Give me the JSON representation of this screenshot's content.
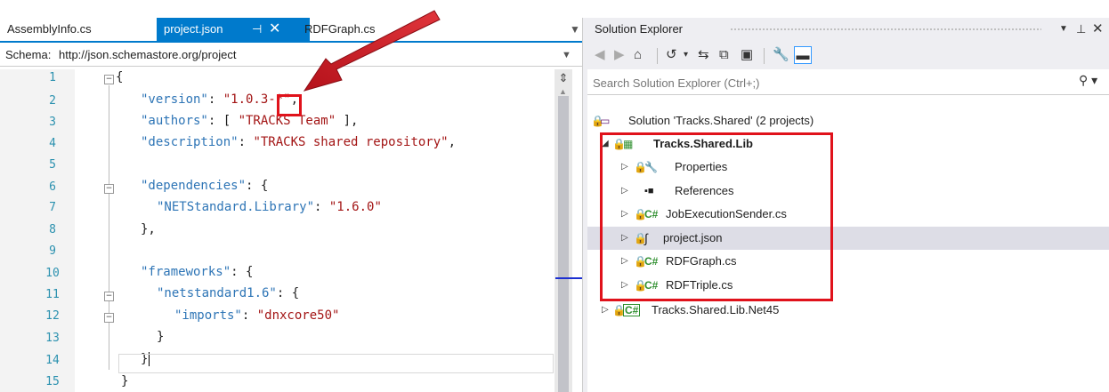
{
  "editor": {
    "tabs": [
      {
        "label": "AssemblyInfo.cs"
      },
      {
        "label": "project.json",
        "active": true
      },
      {
        "label": "RDFGraph.cs"
      }
    ],
    "pin_icon": "pin-icon",
    "close_icon": "close-icon",
    "schema_label": "Schema:",
    "schema_value": "http://json.schemastore.org/project",
    "line_numbers": [
      "1",
      "2",
      "3",
      "4",
      "5",
      "6",
      "7",
      "8",
      "9",
      "10",
      "11",
      "12",
      "13",
      "14",
      "15"
    ],
    "code": {
      "l1": "{",
      "l2_key": "\"version\"",
      "l2_colon": ": ",
      "l2_val": "\"1.0.3-*\"",
      "l2_end": ",",
      "l3_key": "\"authors\"",
      "l3_colon": ": [ ",
      "l3_val": "\"TRACKS Team\"",
      "l3_end": " ],",
      "l4_key": "\"description\"",
      "l4_colon": ": ",
      "l4_val": "\"TRACKS shared repository\"",
      "l4_end": ",",
      "l6_key": "\"dependencies\"",
      "l6_end": ": {",
      "l7_key": "\"NETStandard.Library\"",
      "l7_colon": ": ",
      "l7_val": "\"1.6.0\"",
      "l8": "},",
      "l10_key": "\"frameworks\"",
      "l10_end": ": {",
      "l11_key": "\"netstandard1.6\"",
      "l11_end": ": {",
      "l12_key": "\"imports\"",
      "l12_colon": ": ",
      "l12_val": "\"dnxcore50\"",
      "l13": "}",
      "l14": "}",
      "l15": "}"
    }
  },
  "solution_explorer": {
    "title": "Solution Explorer",
    "search_placeholder": "Search Solution Explorer (Ctrl+;)",
    "tree": {
      "solution": "Solution 'Tracks.Shared' (2 projects)",
      "project": "Tracks.Shared.Lib",
      "items": [
        {
          "label": "Properties",
          "icon": "wrench-icon"
        },
        {
          "label": "References",
          "icon": "references-icon"
        },
        {
          "label": "JobExecutionSender.cs",
          "icon": "csharp-file-icon"
        },
        {
          "label": "project.json",
          "icon": "json-file-icon",
          "selected": true
        },
        {
          "label": "RDFGraph.cs",
          "icon": "csharp-file-icon"
        },
        {
          "label": "RDFTriple.cs",
          "icon": "csharp-file-icon"
        }
      ],
      "project2": "Tracks.Shared.Lib.Net45"
    }
  },
  "colors": {
    "accent": "#007acc",
    "highlight": "#e0121b",
    "key": "#2e75b6",
    "string": "#a31515",
    "line_number": "#2b91af"
  }
}
